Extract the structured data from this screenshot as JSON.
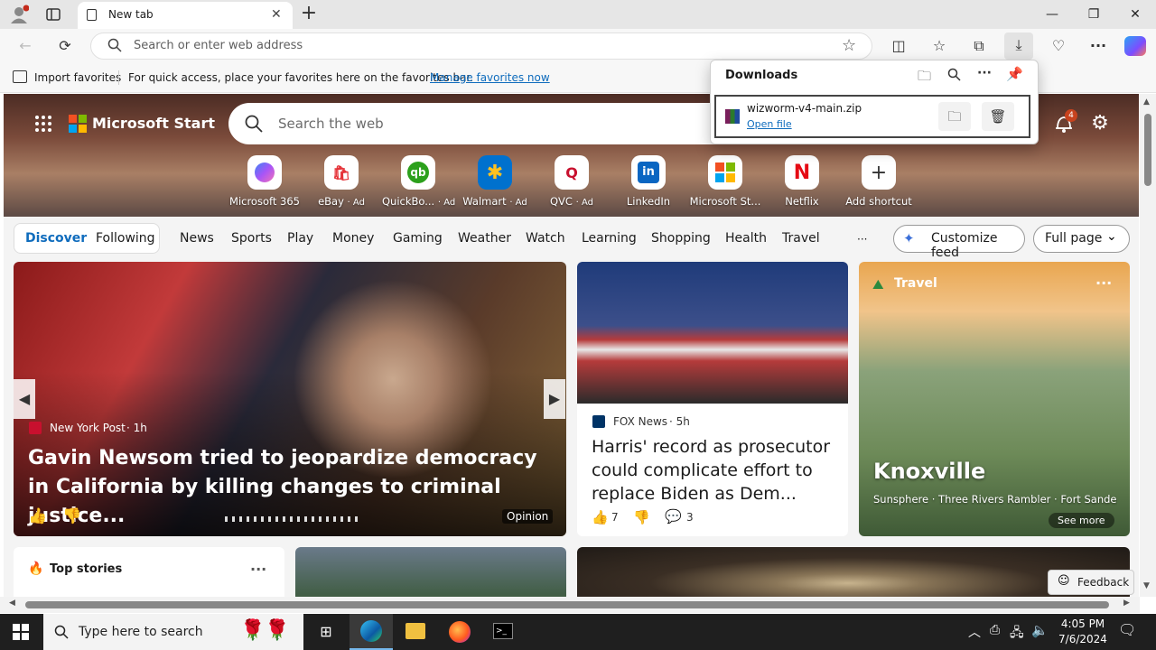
{
  "browser": {
    "tab_title": "New tab",
    "address_placeholder": "Search or enter web address"
  },
  "favorites_bar": {
    "import_label": "Import favorites",
    "message": "For quick access, place your favorites here on the favorites bar.",
    "manage_link": "Manage favorites now"
  },
  "downloads": {
    "title": "Downloads",
    "file_name": "wizworm-v4-main.zip",
    "open_file": "Open file"
  },
  "msn": {
    "brand": "Microsoft Start",
    "search_placeholder": "Search the web",
    "notification_count": "4",
    "shortcuts": [
      {
        "label": "Microsoft 365",
        "ad": ""
      },
      {
        "label": "eBay",
        "ad": "· Ad"
      },
      {
        "label": "QuickBo...",
        "ad": "· Ad"
      },
      {
        "label": "Walmart",
        "ad": "· Ad"
      },
      {
        "label": "QVC",
        "ad": "· Ad"
      },
      {
        "label": "LinkedIn",
        "ad": ""
      },
      {
        "label": "Microsoft St...",
        "ad": ""
      },
      {
        "label": "Netflix",
        "ad": ""
      },
      {
        "label": "Add shortcut",
        "ad": ""
      }
    ],
    "nav": {
      "discover": "Discover",
      "following": "Following",
      "items": [
        "News",
        "Sports",
        "Play",
        "Money",
        "Gaming",
        "Weather",
        "Watch",
        "Learning",
        "Shopping",
        "Health",
        "Travel"
      ],
      "more": "···",
      "customize": "Customize feed",
      "layout": "Full page"
    },
    "hero_article": {
      "source": "New York Post",
      "age": "· 1h",
      "headline": "Gavin Newsom tried to jeopardize democracy in California by killing changes to criminal justice...",
      "tag": "Opinion"
    },
    "article2": {
      "source": "FOX News",
      "age": "· 5h",
      "headline": "Harris' record as prosecutor could complicate effort to replace Biden as Dem...",
      "likes": "7",
      "comments": "3"
    },
    "travel": {
      "label": "Travel",
      "city": "Knoxville",
      "places": "Sunsphere · Three Rivers Rambler · Fort Sanders ·...",
      "see_more": "See more"
    },
    "top_stories": "Top stories",
    "feedback": "Feedback"
  },
  "taskbar": {
    "search_placeholder": "Type here to search",
    "time": "4:05 PM",
    "date": "7/6/2024"
  },
  "colors": {
    "accent": "#0f6cbd",
    "taskbar": "#1f1f1f",
    "notification": "#c8431e"
  }
}
